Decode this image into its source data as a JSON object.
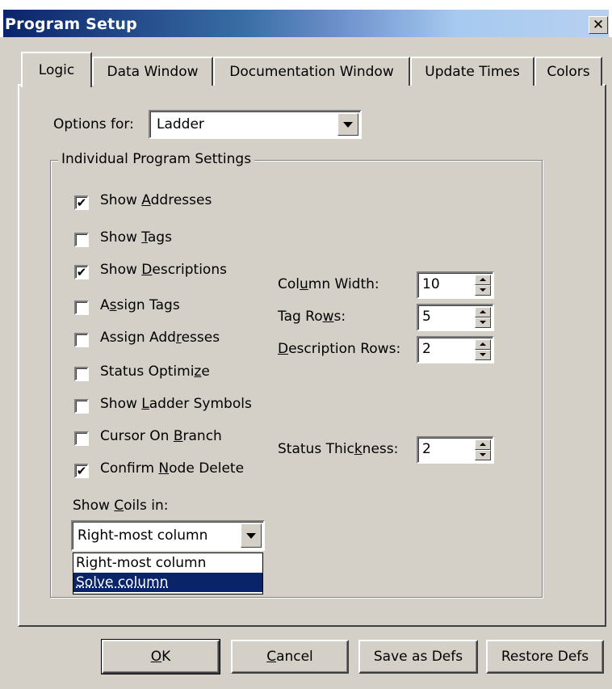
{
  "window": {
    "title": "Program Setup",
    "close_glyph": "✕"
  },
  "tabs": [
    {
      "label": "Logic",
      "active": true
    },
    {
      "label": "Data Window",
      "active": false
    },
    {
      "label": "Documentation Window",
      "active": false
    },
    {
      "label": "Update Times",
      "active": false
    },
    {
      "label": "Colors",
      "active": false
    }
  ],
  "options_for": {
    "label": "Options for:",
    "value": "Ladder"
  },
  "group_label": "Individual Program Settings",
  "checkboxes": [
    {
      "pre": "Show ",
      "ul": "A",
      "post": "ddresses",
      "checked": true
    },
    {
      "pre": "Show ",
      "ul": "T",
      "post": "ags",
      "checked": false
    },
    {
      "pre": "Show ",
      "ul": "D",
      "post": "escriptions",
      "checked": true
    },
    {
      "pre": "A",
      "ul": "s",
      "post": "sign Tags",
      "checked": false
    },
    {
      "pre": "Assign Add",
      "ul": "r",
      "post": "esses",
      "checked": false
    },
    {
      "pre": "Status Optimi",
      "ul": "z",
      "post": "e",
      "checked": false
    },
    {
      "pre": "Show ",
      "ul": "L",
      "post": "adder Symbols",
      "checked": false
    },
    {
      "pre": "Cursor On ",
      "ul": "B",
      "post": "ranch",
      "checked": false
    },
    {
      "pre": "Confirm ",
      "ul": "N",
      "post": "ode Delete",
      "checked": true
    }
  ],
  "spinners": [
    {
      "pre": "Col",
      "ul": "u",
      "post": "mn Width:",
      "value": "10"
    },
    {
      "pre": "Tag Ro",
      "ul": "w",
      "post": "s:",
      "value": "5"
    },
    {
      "pre": "",
      "ul": "D",
      "post": "escription Rows:",
      "value": "2"
    },
    {
      "pre": "Status Thic",
      "ul": "k",
      "post": "ness:",
      "value": "2"
    }
  ],
  "show_coils": {
    "label_pre": "Show ",
    "label_ul": "C",
    "label_post": "oils in:",
    "value": "Right-most column",
    "options": [
      "Right-most column",
      "Solve column"
    ],
    "highlighted": "Solve column"
  },
  "buttons": {
    "ok_ul": "O",
    "ok_post": "K",
    "cancel_ul": "C",
    "cancel_post": "ancel",
    "save_defs": "Save as Defs",
    "restore_defs": "Restore Defs"
  },
  "colors": {
    "title_bar": "#0a246a",
    "face": "#d4d0c8",
    "selection": "#0a246a"
  }
}
